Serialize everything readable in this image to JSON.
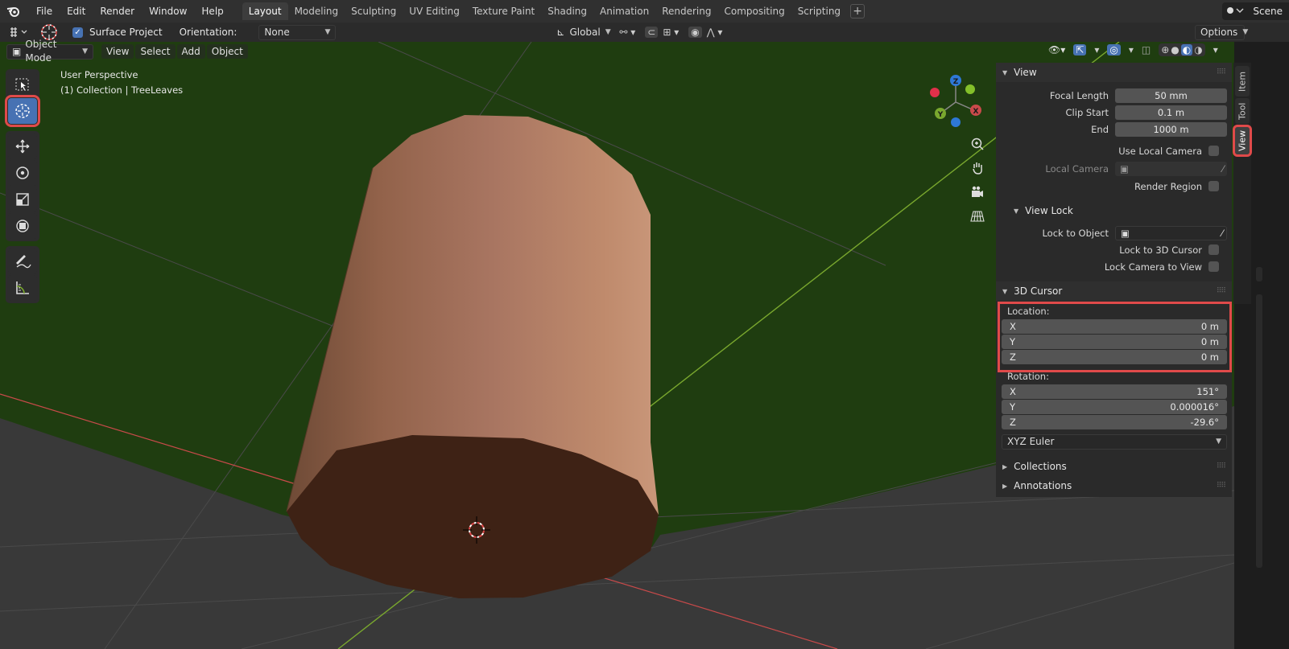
{
  "menu": {
    "items": [
      "File",
      "Edit",
      "Render",
      "Window",
      "Help"
    ]
  },
  "workspaces": {
    "tabs": [
      "Layout",
      "Modeling",
      "Sculpting",
      "UV Editing",
      "Texture Paint",
      "Shading",
      "Animation",
      "Rendering",
      "Compositing",
      "Scripting"
    ],
    "active": "Layout"
  },
  "scene": {
    "label": "Scene"
  },
  "tool_settings": {
    "surface_project_label": "Surface Project",
    "orientation_label": "Orientation:",
    "orientation_value": "None",
    "transform_orientation": "Global",
    "options_label": "Options"
  },
  "viewport_header": {
    "mode": "Object Mode",
    "view": "View",
    "select": "Select",
    "add": "Add",
    "object": "Object"
  },
  "viewport": {
    "perspective": "User Perspective",
    "collection": "(1) Collection | TreeLeaves"
  },
  "gizmo": {
    "axes": [
      "X",
      "Y",
      "Z"
    ]
  },
  "sidebar": {
    "tabs": [
      "Item",
      "Tool",
      "View"
    ],
    "active_tab": "View",
    "view_panel": {
      "title": "View",
      "focal_length_label": "Focal Length",
      "focal_length": "50 mm",
      "clip_start_label": "Clip Start",
      "clip_start": "0.1 m",
      "end_label": "End",
      "end": "1000 m",
      "use_local_camera": "Use Local Camera",
      "local_camera": "Local Camera",
      "render_region": "Render Region"
    },
    "view_lock": {
      "title": "View Lock",
      "lock_to_object": "Lock to Object",
      "lock_to_cursor": "Lock to 3D Cursor",
      "lock_camera": "Lock Camera to View"
    },
    "cursor_panel": {
      "title": "3D Cursor",
      "location_label": "Location:",
      "location": [
        {
          "axis": "X",
          "value": "0 m"
        },
        {
          "axis": "Y",
          "value": "0 m"
        },
        {
          "axis": "Z",
          "value": "0 m"
        }
      ],
      "rotation_label": "Rotation:",
      "rotation": [
        {
          "axis": "X",
          "value": "151°"
        },
        {
          "axis": "Y",
          "value": "0.000016°"
        },
        {
          "axis": "Z",
          "value": "-29.6°"
        }
      ],
      "rotation_mode": "XYZ Euler"
    },
    "collections": "Collections",
    "annotations": "Annotations"
  },
  "colors": {
    "accent": "#4772b3",
    "highlight": "#e04a4a",
    "ground": "#1f3d10",
    "cylinder": "#b57a5e",
    "cylinder_base": "#3e2215"
  }
}
